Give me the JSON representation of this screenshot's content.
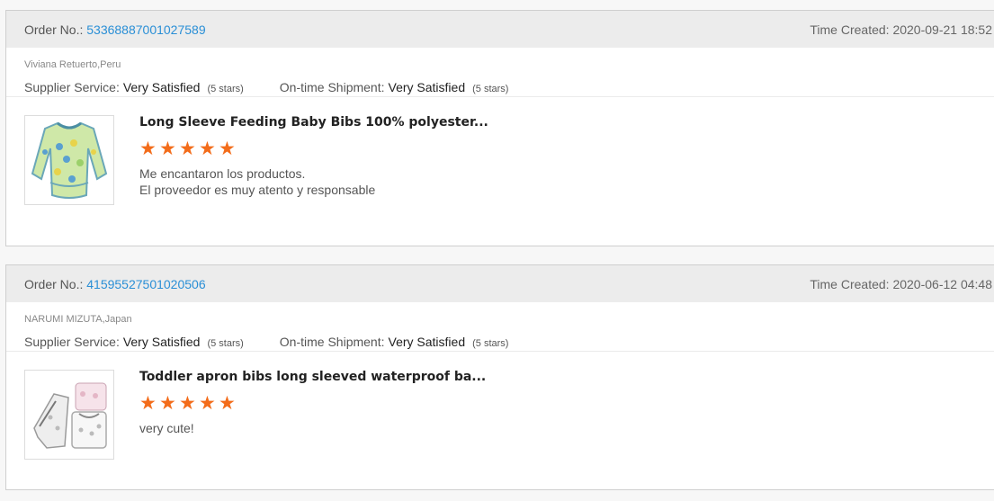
{
  "orders": [
    {
      "order_label": "Order No.:",
      "order_number": "53368887001027589",
      "time_label": "Time Created:",
      "time_value": "2020-09-21 18:52",
      "buyer": "Viviana Retuerto,Peru",
      "supplier_label": "Supplier Service:",
      "supplier_value": "Very Satisfied",
      "supplier_stars": "(5 stars)",
      "shipment_label": "On-time Shipment:",
      "shipment_value": "Very Satisfied",
      "shipment_stars": "(5 stars)",
      "product_title": "Long Sleeve Feeding Baby Bibs 100% polyester...",
      "rating": 5,
      "comment_line1": "Me encantaron los productos.",
      "comment_line2": "El proveedor es muy atento y responsable"
    },
    {
      "order_label": "Order No.:",
      "order_number": "41595527501020506",
      "time_label": "Time Created:",
      "time_value": "2020-06-12 04:48",
      "buyer": "NARUMI MIZUTA,Japan",
      "supplier_label": "Supplier Service:",
      "supplier_value": "Very Satisfied",
      "supplier_stars": "(5 stars)",
      "shipment_label": "On-time Shipment:",
      "shipment_value": "Very Satisfied",
      "shipment_stars": "(5 stars)",
      "product_title": "Toddler apron bibs long sleeved waterproof ba...",
      "rating": 5,
      "comment_line1": "very cute!",
      "comment_line2": ""
    }
  ],
  "colors": {
    "star": "#f36c1a",
    "link": "#2a8fd6",
    "header_bg": "#ececec"
  },
  "icons": {
    "star": "star-icon"
  }
}
